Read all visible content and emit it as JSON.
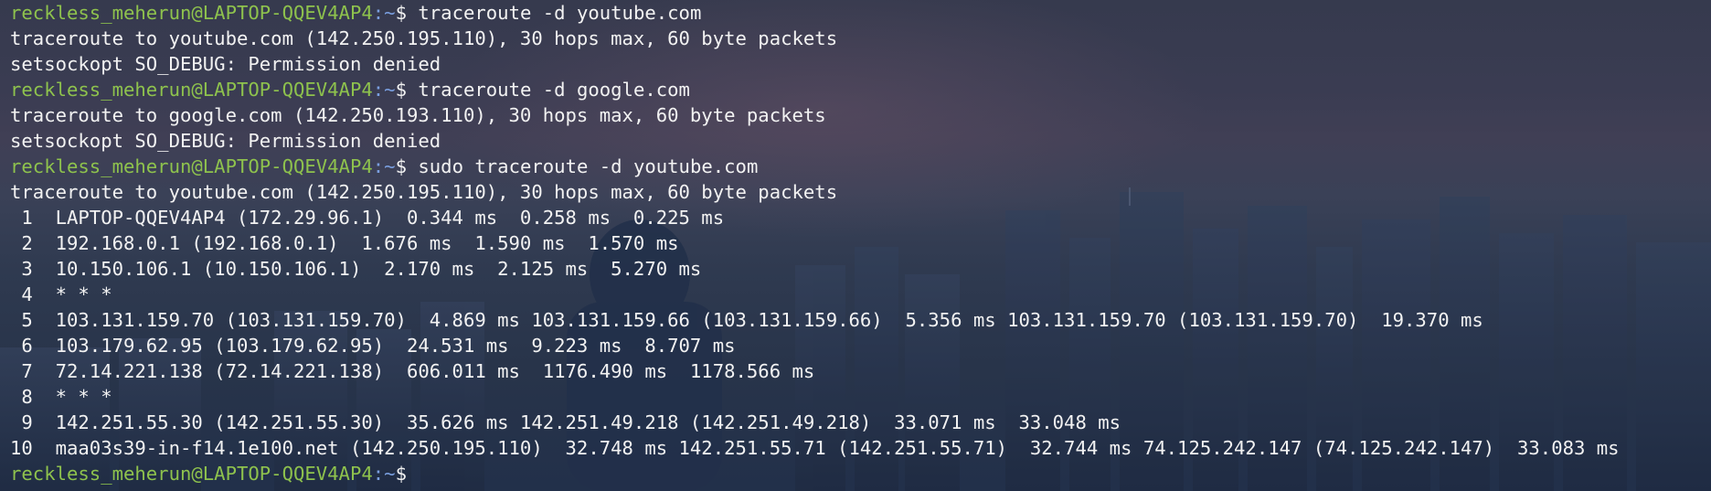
{
  "colors": {
    "prompt_user": "#8ec24d",
    "prompt_path": "#7a9fe0",
    "text": "#f2f2f2",
    "background": "#2c3448"
  },
  "prompt": {
    "user_host": "reckless_meherun@LAPTOP-QQEV4AP4",
    "path": ":~",
    "symbol": "$"
  },
  "lines": [
    {
      "type": "prompt",
      "command": "traceroute -d youtube.com"
    },
    {
      "type": "output",
      "text": "traceroute to youtube.com (142.250.195.110), 30 hops max, 60 byte packets"
    },
    {
      "type": "output",
      "text": "setsockopt SO_DEBUG: Permission denied"
    },
    {
      "type": "prompt",
      "command": "traceroute -d google.com"
    },
    {
      "type": "output",
      "text": "traceroute to google.com (142.250.193.110), 30 hops max, 60 byte packets"
    },
    {
      "type": "output",
      "text": "setsockopt SO_DEBUG: Permission denied"
    },
    {
      "type": "prompt",
      "command": "sudo traceroute -d youtube.com"
    },
    {
      "type": "output",
      "text": "traceroute to youtube.com (142.250.195.110), 30 hops max, 60 byte packets"
    },
    {
      "type": "output",
      "text": " 1  LAPTOP-QQEV4AP4 (172.29.96.1)  0.344 ms  0.258 ms  0.225 ms"
    },
    {
      "type": "output",
      "text": " 2  192.168.0.1 (192.168.0.1)  1.676 ms  1.590 ms  1.570 ms"
    },
    {
      "type": "output",
      "text": " 3  10.150.106.1 (10.150.106.1)  2.170 ms  2.125 ms  5.270 ms"
    },
    {
      "type": "output",
      "text": " 4  * * *"
    },
    {
      "type": "output",
      "text": " 5  103.131.159.70 (103.131.159.70)  4.869 ms 103.131.159.66 (103.131.159.66)  5.356 ms 103.131.159.70 (103.131.159.70)  19.370 ms"
    },
    {
      "type": "output",
      "text": " 6  103.179.62.95 (103.179.62.95)  24.531 ms  9.223 ms  8.707 ms"
    },
    {
      "type": "output",
      "text": " 7  72.14.221.138 (72.14.221.138)  606.011 ms  1176.490 ms  1178.566 ms"
    },
    {
      "type": "output",
      "text": " 8  * * *"
    },
    {
      "type": "output",
      "text": " 9  142.251.55.30 (142.251.55.30)  35.626 ms 142.251.49.218 (142.251.49.218)  33.071 ms  33.048 ms"
    },
    {
      "type": "output",
      "text": "10  maa03s39-in-f14.1e100.net (142.250.195.110)  32.748 ms 142.251.55.71 (142.251.55.71)  32.744 ms 74.125.242.147 (74.125.242.147)  33.083 ms"
    },
    {
      "type": "prompt",
      "command": ""
    }
  ]
}
